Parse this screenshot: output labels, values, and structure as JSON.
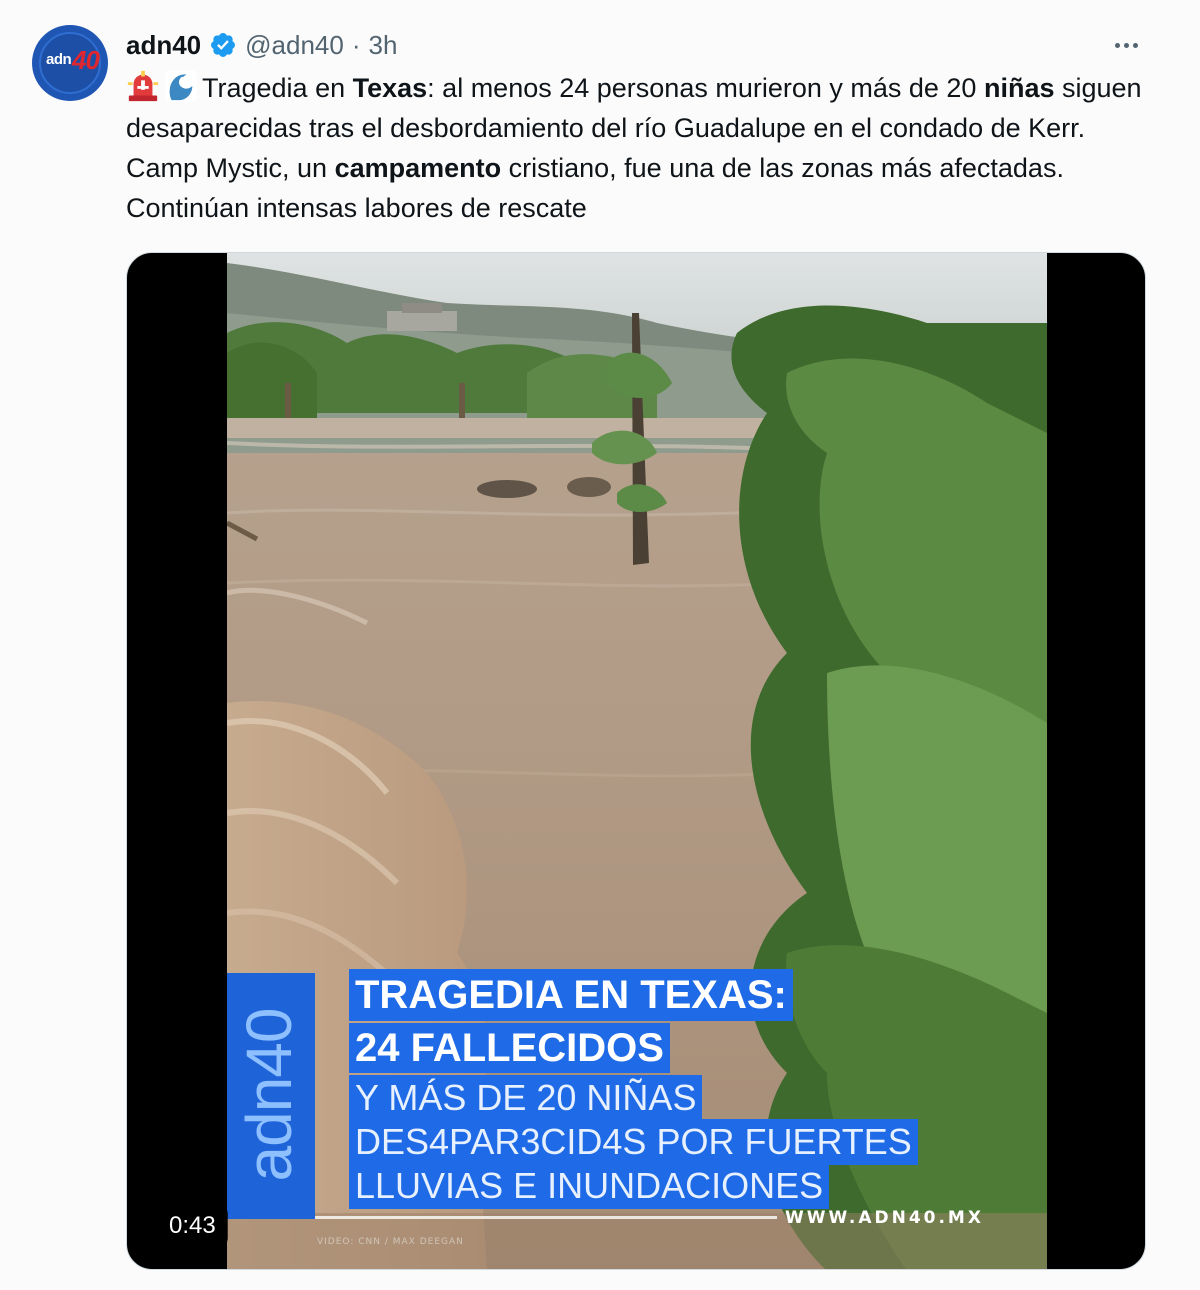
{
  "tweet": {
    "avatar_alt": "adn40",
    "avatar_text_1": "adn",
    "avatar_text_2": "40",
    "display_name": "adn40",
    "handle": "@adn40",
    "separator": "·",
    "time": "3h",
    "more_icon": "more-horizontal-icon",
    "verified_icon": "verified-badge-icon",
    "text": {
      "emoji_1": "rotating-light-emoji",
      "emoji_2": "water-wave-emoji",
      "p1": "Tragedia en ",
      "b1": "Texas",
      "p2": ": al menos 24 personas murieron y más de 20 ",
      "b2": "niñas",
      "p3": " siguen desaparecidas tras el desbordamiento del río Guadalupe en el condado de Kerr. Camp Mystic, un ",
      "b3": "campamento",
      "p4": " cristiano, fue una de las zonas más afectadas. Continúan intensas labores de rescate"
    },
    "video": {
      "duration": "0:43",
      "logo_text": "adn40",
      "caption": [
        "TRAGEDIA EN TEXAS:",
        "24 FALLECIDOS",
        "Y MÁS DE 20 NIÑAS",
        "DES4PAR3CID4S POR FUERTES",
        "LLUVIAS E INUNDACIONES"
      ],
      "site": "WWW.ADN40.MX",
      "credit": "VIDEO: CNN / MAX DEEGAN"
    }
  },
  "colors": {
    "verified": "#1d9bf0",
    "caption_bg": "#1f6ae6",
    "logo_bar": "#1e63d8",
    "water": "#b39a83"
  }
}
